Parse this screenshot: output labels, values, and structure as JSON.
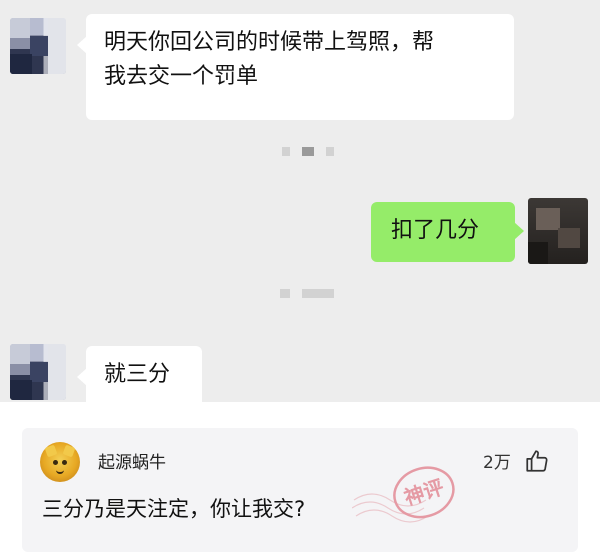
{
  "chat": {
    "messages": [
      {
        "side": "left",
        "text_line1": "明天你回公司的时候带上驾照，帮",
        "text_line2": "我去交一个罚单"
      },
      {
        "side": "right",
        "text": "扣了几分"
      },
      {
        "side": "left",
        "text": "就三分"
      }
    ],
    "colors": {
      "background": "#ededed",
      "bubble_left": "#ffffff",
      "bubble_right": "#95ec69"
    }
  },
  "comment": {
    "username": "起源蜗牛",
    "likes": "2万",
    "text": "三分乃是天注定，你让我交?",
    "stamp_text": "神评",
    "icons": {
      "avatar": "cat-avatar-icon",
      "like": "thumbs-up-icon",
      "stamp": "god-comment-stamp-icon"
    },
    "colors": {
      "card_background": "#f4f4f6",
      "stamp": "#e8a0a8"
    }
  }
}
